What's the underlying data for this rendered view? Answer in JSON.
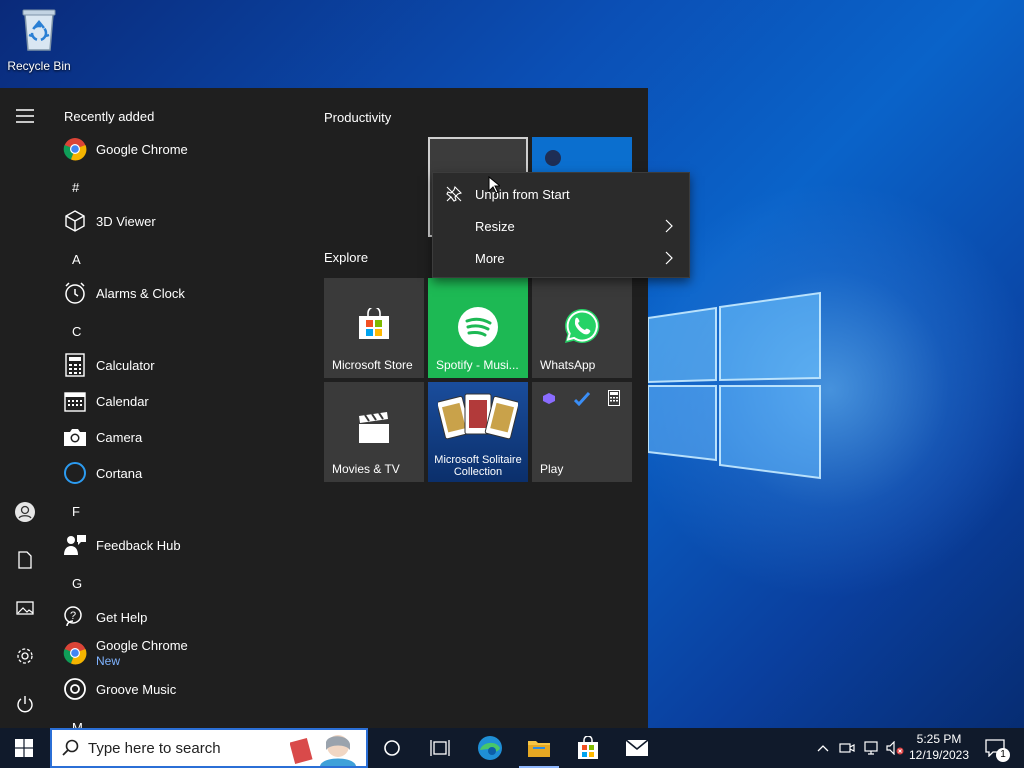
{
  "desktop": {
    "recycle_bin_label": "Recycle Bin"
  },
  "start_menu": {
    "recently_added_header": "Recently added",
    "apps": [
      {
        "name": "Google Chrome",
        "icon": "chrome-icon"
      },
      {
        "letter": "#"
      },
      {
        "name": "3D Viewer",
        "icon": "cube-icon"
      },
      {
        "letter": "A"
      },
      {
        "name": "Alarms & Clock",
        "icon": "clock-icon"
      },
      {
        "letter": "C"
      },
      {
        "name": "Calculator",
        "icon": "calculator-icon"
      },
      {
        "name": "Calendar",
        "icon": "calendar-icon"
      },
      {
        "name": "Camera",
        "icon": "camera-icon"
      },
      {
        "name": "Cortana",
        "icon": "cortana-icon"
      },
      {
        "letter": "F"
      },
      {
        "name": "Feedback Hub",
        "icon": "feedback-icon"
      },
      {
        "letter": "G"
      },
      {
        "name": "Get Help",
        "icon": "help-icon"
      },
      {
        "name": "Google Chrome",
        "sub": "New",
        "icon": "chrome-icon"
      },
      {
        "name": "Groove Music",
        "icon": "music-icon"
      },
      {
        "letter": "M"
      }
    ],
    "letters": {
      "hash": "#",
      "a": "A",
      "c": "C",
      "f": "F",
      "g": "G",
      "m": "M"
    },
    "app_names": {
      "chrome": "Google Chrome",
      "viewer3d": "3D Viewer",
      "alarms": "Alarms & Clock",
      "calculator": "Calculator",
      "calendar": "Calendar",
      "camera": "Camera",
      "cortana": "Cortana",
      "feedback": "Feedback Hub",
      "gethelp": "Get Help",
      "chrome2": "Google Chrome",
      "chrome2_sub": "New",
      "groove": "Groove Music"
    },
    "groups": {
      "productivity": "Productivity",
      "explore": "Explore"
    },
    "tiles": {
      "store": "Microsoft Store",
      "spotify": "Spotify - Musi...",
      "whatsapp": "WhatsApp",
      "movies": "Movies & TV",
      "solitaire": "Microsoft Solitaire Collection",
      "play": "Play"
    }
  },
  "context_menu": {
    "unpin": "Unpin from Start",
    "resize": "Resize",
    "more": "More"
  },
  "taskbar": {
    "search_placeholder": "Type here to search",
    "time": "5:25 PM",
    "date": "12/19/2023",
    "notification_count": "1"
  },
  "colors": {
    "start_bg": "#1f1f1f",
    "tile_bg": "#3a3a3a",
    "spotify_green": "#1db954",
    "accent_blue": "#0078d7",
    "taskbar_bg": "#101a2b"
  }
}
